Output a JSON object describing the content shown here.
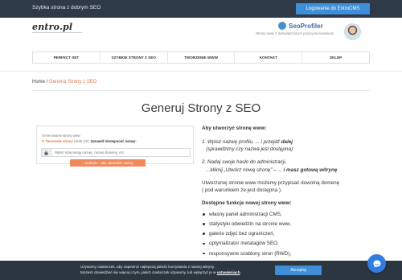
{
  "topbar": {
    "tagline": "Szybka strona z dobrym SEO",
    "login_label": "Logowanie do EntroCMS"
  },
  "header": {
    "logo_text": "entro.pl",
    "profiler_name": "SeoProfiler",
    "profiler_sub": "Strony www z doświadczonym pozycjonerowaniem"
  },
  "nav": {
    "items": [
      "PERFECT SET",
      "SZYBKIE STRONY Z SEO",
      "TWORZENIE WWW",
      "KONTAKT",
      "SKLEP"
    ]
  },
  "breadcrumb": {
    "home": "Home",
    "sep": "/",
    "current": "Generuj Strony z SEO"
  },
  "page": {
    "title": "Generuj Strony z SEO"
  },
  "widget": {
    "label": "Generowanie strony www",
    "step_icon": "pencil-icon",
    "step_current": "Tworzenie strony",
    "step_count": "| krok 1/2 |",
    "step_check": "Sprawdź dostępność nazwy:",
    "input_placeholder": "Wpisz tutaj swoją nazwę, nazwę domeny, etc.",
    "lock_icon": "lock-icon",
    "check_label": "KLIKNIJ – aby sprawdzić nazwę"
  },
  "info": {
    "question": "Aby utworzyć stronę www:",
    "step1_a": "1. Wpisz nazwę profilu, ... i przejdź ",
    "step1_b": "dalej",
    "step1_c": "(sprawdzimy czy nazwa jest dostępna)",
    "step2_a": "2. Nadaj swoje hasło do administracji,",
    "step2_b": "...kliknij „Utwórz nową stronę” – ... ",
    "step2_c": "i masz gotową witrynę",
    "para_a": "Utworzonej stronie www możemy przypisać dowolną domenę",
    "para_b": "( pod warunkiem że jest dostępna ).",
    "features_heading": "Dostępne funkcje nowej strony www:",
    "features": [
      "własny panel administracji CMS,",
      "statystyki odwiedzin na stronie www,",
      "galerie zdjęć bez ograniczeń,",
      "optymalizator metatagów SEO,",
      "responsywne szablony stron (RWD),"
    ]
  },
  "cookie": {
    "line1": "Używamy ciasteczek, aby zapewnić najlepszą jakość korzystania z naszej witryny.",
    "line2": "Możesz dowiedzieć się więcej o tym, jakich ciasteczek używamy, lub wyłączyć je w ",
    "link": "ustawieniach",
    "accept_label": "Akceptuj"
  },
  "chat": {
    "icon": "chat-icon"
  },
  "colors": {
    "topbar_bg": "#2e3a47",
    "accent_blue": "#3f8fd8",
    "accent_orange": "#f08a5d",
    "cookie_bg": "#2c3640"
  }
}
